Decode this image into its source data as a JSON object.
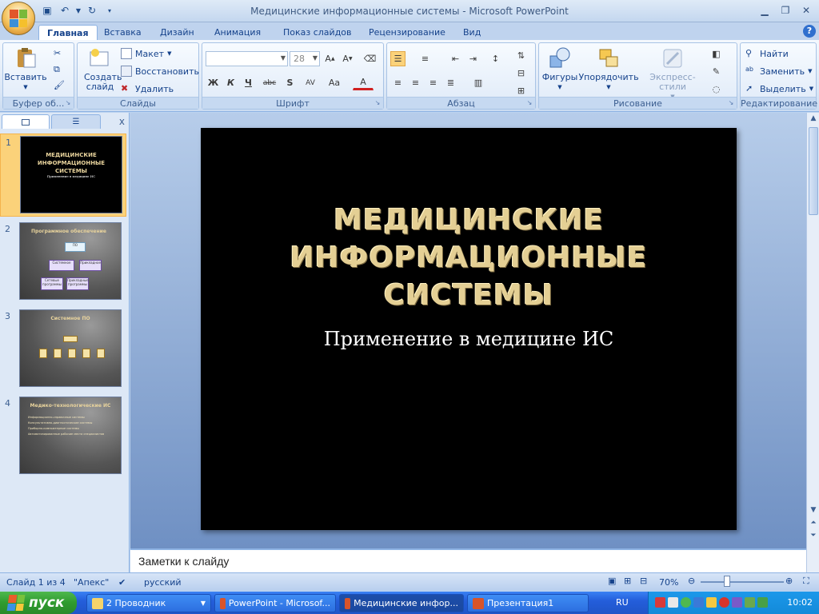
{
  "window": {
    "title": "Медицинские информационные системы - Microsoft PowerPoint"
  },
  "tabs": [
    "Главная",
    "Вставка",
    "Дизайн",
    "Анимация",
    "Показ слайдов",
    "Рецензирование",
    "Вид"
  ],
  "ribbon": {
    "clipboard": {
      "label": "Буфер об...",
      "paste": "Вставить"
    },
    "slides": {
      "label": "Слайды",
      "new_slide": "Создать слайд",
      "layout": "Макет",
      "reset": "Восстановить",
      "delete": "Удалить"
    },
    "font": {
      "label": "Шрифт",
      "size": "28",
      "bold": "Ж",
      "italic": "К",
      "underline": "Ч",
      "strike": "abc",
      "shadow": "S",
      "spacing": "AV",
      "case": "Aa",
      "color": "A"
    },
    "paragraph": {
      "label": "Абзац"
    },
    "drawing": {
      "label": "Рисование",
      "shapes": "Фигуры",
      "arrange": "Упорядочить",
      "quick_styles": "Экспресс-стили"
    },
    "editing": {
      "label": "Редактирование",
      "find": "Найти",
      "replace": "Заменить",
      "select": "Выделить"
    }
  },
  "slides_panel": {
    "slides": [
      {
        "num": "1",
        "title": "МЕДИЦИНСКИЕ ИНФОРМАЦИОННЫЕ СИСТЕМЫ",
        "subtitle": "Применение в медицине ИС"
      },
      {
        "num": "2",
        "title": "Программное обеспечение",
        "boxes": [
          "ПО",
          "Системное",
          "Прикладное",
          "Сетевые программы",
          "Прикладные программы"
        ]
      },
      {
        "num": "3",
        "title": "Системное ПО"
      },
      {
        "num": "4",
        "title": "Медико-технологические ИС",
        "bullets": [
          "Информационно-справочные системы",
          "Консультативно-диагностические системы",
          "Приборно-компьютерные системы",
          "Автоматизированные рабочие места специалистов"
        ]
      }
    ]
  },
  "slide": {
    "title": "МЕДИЦИНСКИЕ ИНФОРМАЦИОННЫЕ СИСТЕМЫ",
    "subtitle": "Применение в медицине ИС"
  },
  "notes": {
    "placeholder": "Заметки к слайду"
  },
  "statusbar": {
    "slide_info": "Слайд 1 из 4",
    "theme": "\"Апекс\"",
    "language": "русский",
    "zoom": "70%"
  },
  "taskbar": {
    "start": "пуск",
    "tasks": [
      "2 Проводник",
      "PowerPoint - Microsof...",
      "Медицинские инфор...",
      "Презентация1"
    ],
    "lang": "RU",
    "clock": "10:02"
  },
  "colors": {
    "title_gold": "#e4cf94",
    "ribbon_blue": "#15428b",
    "selected_thumb": "#fbd27a"
  }
}
